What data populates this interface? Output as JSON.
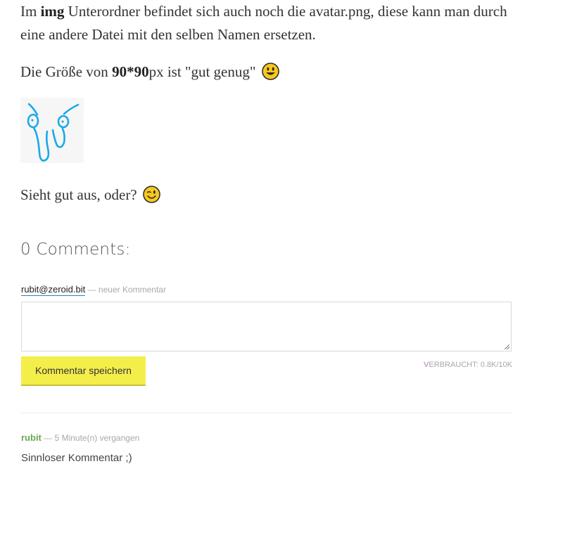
{
  "post": {
    "p1_prefix": "Im ",
    "p1_bold": "img",
    "p1_text": " Unterordner befindet sich auch noch die avatar.png, diese kann man durch eine andere Datei mit den selben Namen ersetzen.",
    "p2_prefix": "Die Größe von ",
    "p2_bold": "90*90",
    "p2_suffix": "px ist \"gut genug\"",
    "p2_emoji": "smiley-emoji",
    "p3_text": "Sieht gut aus, oder?",
    "p3_emoji": "wink-emoji",
    "avatar_icon": "doodle-face-avatar",
    "avatar_color": "#1aa9e8"
  },
  "comments": {
    "title": "0 Comments:",
    "new_comment": {
      "user": "rubit@zeroid.bit",
      "meta": " — neuer Kommentar",
      "textarea_value": "",
      "save_label": "Kommentar speichern",
      "quota_v": "V",
      "quota_rest": "ERBRAUCHT: 0.8K/10K"
    },
    "list": [
      {
        "user": "rubit",
        "meta": " — 5 Minute(n) vergangen",
        "body": "Sinnloser Kommentar ;)"
      }
    ]
  },
  "colors": {
    "button_bg": "#f4ee4a",
    "commenter_name": "#6aa84f",
    "link_underline": "#2a7fc4",
    "quota_accent": "#b276c2"
  }
}
